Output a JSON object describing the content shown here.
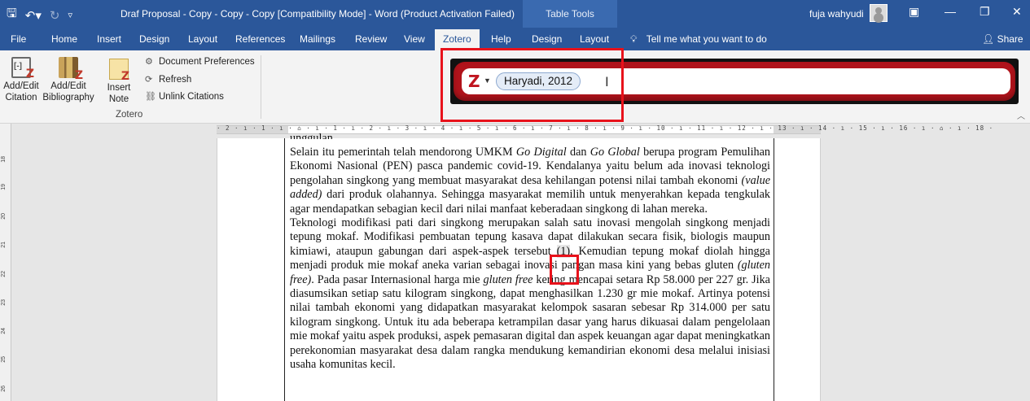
{
  "titlebar": {
    "doc_title": "Draf Proposal - Copy - Copy - Copy [Compatibility Mode]  -  Word (Product Activation Failed)",
    "context_tab": "Table Tools",
    "user_name": "fuja wahyudi"
  },
  "tabs": {
    "items": [
      "File",
      "Home",
      "Insert",
      "Design",
      "Layout",
      "References",
      "Mailings",
      "Review",
      "View",
      "Zotero",
      "Help",
      "Design",
      "Layout"
    ],
    "active": "Zotero",
    "tell_me": "Tell me what you want to do",
    "share": "Share"
  },
  "ribbon": {
    "add_edit_citation": [
      "Add/Edit",
      "Citation"
    ],
    "add_edit_bibliography": [
      "Add/Edit",
      "Bibliography"
    ],
    "insert_note": [
      "Insert",
      "Note"
    ],
    "document_preferences": "Document Preferences",
    "refresh": "Refresh",
    "unlink_citations": "Unlink Citations",
    "group_label": "Zotero"
  },
  "zotero_bar": {
    "citation_bubble": "Haryadi, 2012"
  },
  "ruler": {
    "horizontal": "· 2 · ı · 1 · ı · ⌂ · ı · 1 · ı · 2 · ı · 3 · ı · 4 · ı · 5 · ı · 6 · ı · 7 · ı · 8 · ı · 9 · ı · 10 · ı · 11 · ı · 12 · ı · 13 · ı · 14 · ı · 15 · ı · 16 · ı · ⌂ · ı · 18 ·",
    "vertical": [
      "18",
      "19",
      "20",
      "21",
      "22",
      "23",
      "24",
      "25",
      "26"
    ]
  },
  "document": {
    "top_fragment": "unggulan.",
    "para1": "Selain itu pemerintah telah mendorong UMKM Go Digital dan Go Global berupa program Pemulihan Ekonomi Nasional (PEN) pasca pandemic covid-19. Kendalanya yaitu belum ada inovasi teknologi pengolahan singkong yang membuat masyarakat desa kehilangan potensi nilai tambah ekonomi (value added) dari produk olahannya. Sehingga masyarakat memilih untuk menyerahkan kepada tengkulak agar mendapatkan sebagian kecil dari nilai manfaat keberadaan singkong di lahan mereka.",
    "para2_a": "Teknologi modifikasi pati dari singkong merupakan salah satu inovasi mengolah singkong menjadi tepung mokaf. Modifikasi pembuatan tepung kasava dapat dilakukan secara fisik, biologis maupun kimiawi, ataupun gabungan dari aspek-aspek tersebut ",
    "citation_marker": "(1)",
    "para2_b": ". Kemudian tepung mokaf diolah hingga menjadi produk mie mokaf aneka varian sebagai inovasi pangan masa kini yang bebas gluten ",
    "para2_gluten": "(gluten free)",
    "para2_c": ". Pada pasar Internasional harga mie ",
    "para2_gluten2": "gluten free",
    "para2_d": " kering mencapai setara Rp 58.000 per 227 gr. Jika diasumsikan setiap satu kilogram singkong, dapat menghasilkan 1.230 gr mie mokaf. Artinya potensi nilai tambah ekonomi yang didapatkan masyarakat kelompok sasaran sebesar Rp 314.000 per satu kilogram singkong. Untuk itu ada beberapa ketrampilan dasar yang harus dikuasai dalam pengelolaan mie mokaf yaitu aspek produksi, aspek pemasaran digital dan aspek keuangan agar dapat meningkatkan perekonomian masyarakat desa dalam rangka mendukung kemandirian ekonomi desa melalui inisiasi usaha komunitas kecil."
  },
  "colors": {
    "word_blue": "#2b579a",
    "zotero_red": "#b0131b",
    "highlight_red": "#e8121b"
  }
}
